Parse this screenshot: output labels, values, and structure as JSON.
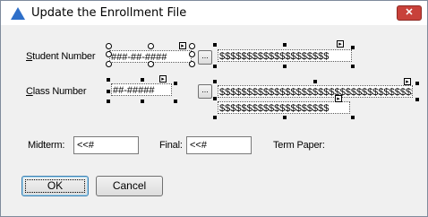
{
  "window": {
    "title": "Update the Enrollment File",
    "close_glyph": "✕"
  },
  "student": {
    "label_accel": "S",
    "label_rest": "tudent Number",
    "mask": "###-##-####",
    "lookup_glyph": "...",
    "name_mask": "$$$$$$$$$$$$$$$$$$$$"
  },
  "class": {
    "label_accel": "C",
    "label_rest": "lass Number",
    "mask": "##-#####",
    "lookup_glyph": "...",
    "name_mask_line1": "$$$$$$$$$$$$$$$$$$$$$$$$$$$$$$$$$$$$$$$",
    "name_mask_line2": "$$$$$$$$$$$$$$$$$$$$"
  },
  "grades": {
    "midterm_label": "Midterm:",
    "midterm_value": "<<#",
    "final_label": "Final:",
    "final_value": "<<#",
    "term_paper_label": "Term Paper:"
  },
  "buttons": {
    "ok": "OK",
    "cancel": "Cancel"
  },
  "colors": {
    "title_icon": "#2e6fc9",
    "close_bg": "#c8413a",
    "default_button_border": "#3c7fb1"
  }
}
